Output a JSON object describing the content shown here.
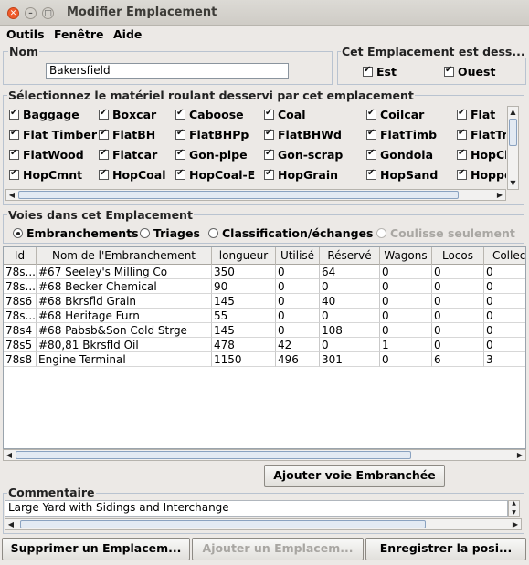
{
  "window": {
    "title": "Modifier Emplacement"
  },
  "menu": [
    "Outils",
    "Fenêtre",
    "Aide"
  ],
  "name_group": {
    "title": "Nom",
    "value": "Bakersfield"
  },
  "served_group": {
    "title": "Cet Emplacement est dess...",
    "options": [
      {
        "label": "Est",
        "checked": true
      },
      {
        "label": "Ouest",
        "checked": true
      }
    ]
  },
  "rolling_stock": {
    "title": "Sélectionnez le matériel roulant desservi par cet emplacement",
    "rows": [
      [
        "Baggage",
        "Boxcar",
        "Caboose",
        "Coal",
        "Coilcar",
        "Flat"
      ],
      [
        "Flat Timber",
        "FlatBH",
        "FlatBHPp",
        "FlatBHWd",
        "FlatTimb",
        "FlatTr"
      ],
      [
        "FlatWood",
        "Flatcar",
        "Gon-pipe",
        "Gon-scrap",
        "Gondola",
        "HopCl"
      ],
      [
        "HopCmnt",
        "HopCoal",
        "HopCoal-E",
        "HopGrain",
        "HopSand",
        "Hoppe"
      ]
    ]
  },
  "tracks": {
    "title": "Voies dans cet Emplacement",
    "options": [
      {
        "label": "Embranchements",
        "selected": true,
        "enabled": true
      },
      {
        "label": "Triages",
        "selected": false,
        "enabled": true
      },
      {
        "label": "Classification/échanges",
        "selected": false,
        "enabled": true
      },
      {
        "label": "Coulisse seulement",
        "selected": false,
        "enabled": false
      }
    ]
  },
  "table": {
    "columns": [
      "Id",
      "Nom de l'Embranchement",
      "longueur",
      "Utilisé",
      "Réservé",
      "Wagons",
      "Locos",
      "Collect"
    ],
    "rows": [
      [
        "78s...",
        "#67 Seeley's Milling Co",
        "350",
        "0",
        "64",
        "0",
        "0",
        "0"
      ],
      [
        "78s...",
        "#68 Becker Chemical",
        "90",
        "0",
        "0",
        "0",
        "0",
        "0"
      ],
      [
        "78s6",
        "#68 Bkrsfld Grain",
        "145",
        "0",
        "40",
        "0",
        "0",
        "0"
      ],
      [
        "78s...",
        "#68 Heritage Furn",
        "55",
        "0",
        "0",
        "0",
        "0",
        "0"
      ],
      [
        "78s4",
        "#68 Pabsb&Son Cold Strge",
        "145",
        "0",
        "108",
        "0",
        "0",
        "0"
      ],
      [
        "78s5",
        "#80,81 Bkrsfld Oil",
        "478",
        "42",
        "0",
        "1",
        "0",
        "0"
      ],
      [
        "78s8",
        "Engine Terminal",
        "1150",
        "496",
        "301",
        "0",
        "6",
        "3"
      ]
    ]
  },
  "add_track_button": "Ajouter voie Embranchée",
  "comment": {
    "title": "Commentaire",
    "value": "Large Yard with Sidings and Interchange"
  },
  "buttons": {
    "delete": "Supprimer un Emplacem...",
    "add": "Ajouter un Emplacem...",
    "save": "Enregistrer la posi..."
  }
}
